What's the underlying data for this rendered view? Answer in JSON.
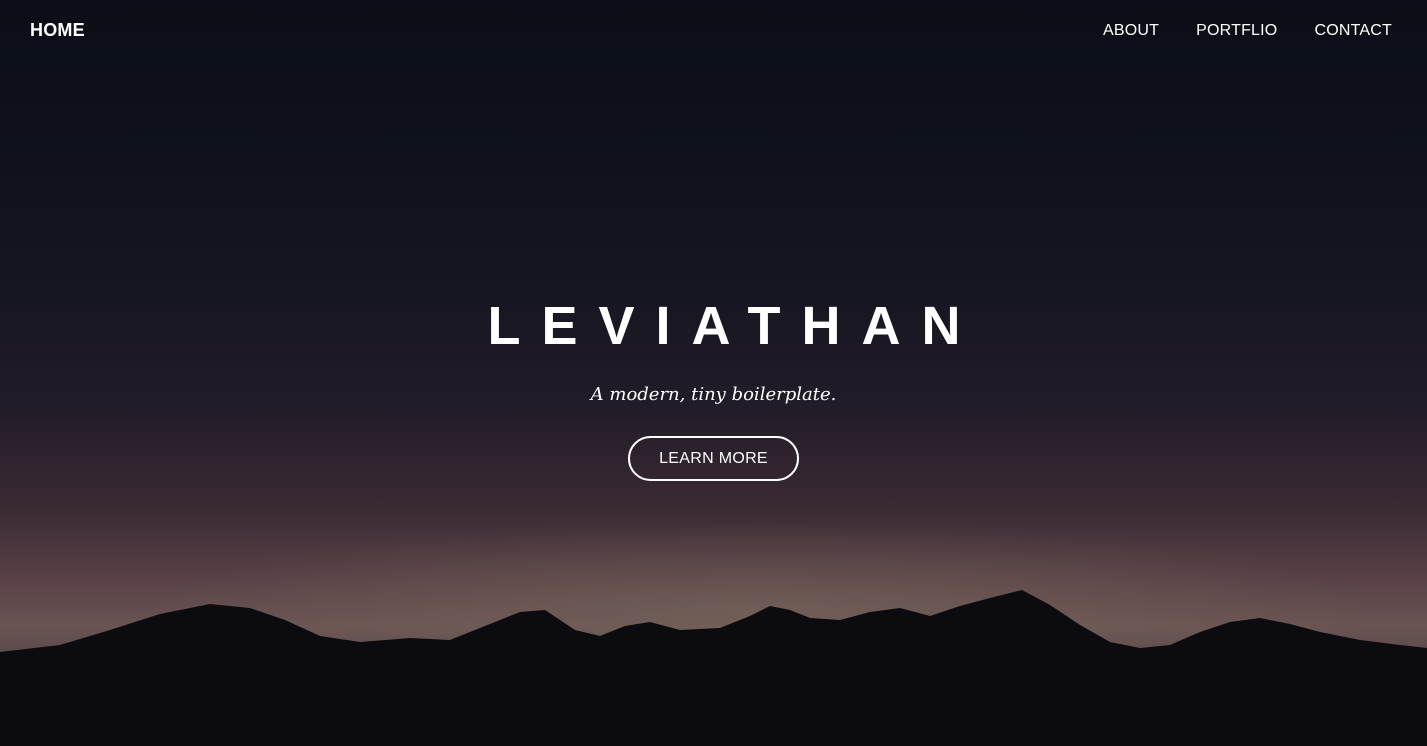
{
  "nav": {
    "home_label": "HOME",
    "links": [
      {
        "label": "ABOUT"
      },
      {
        "label": "PORTFLIO"
      },
      {
        "label": "CONTACT"
      }
    ]
  },
  "hero": {
    "title": "LEVIATHAN",
    "subtitle": "A modern, tiny boilerplate.",
    "cta_label": "LEARN MORE",
    "background_image": "night sky over mountain silhouette at dusk"
  },
  "colors": {
    "text": "#ffffff",
    "sky_top": "#0b0e16",
    "horizon_glow": "#6a5453",
    "mountain": "#0c0b10"
  }
}
